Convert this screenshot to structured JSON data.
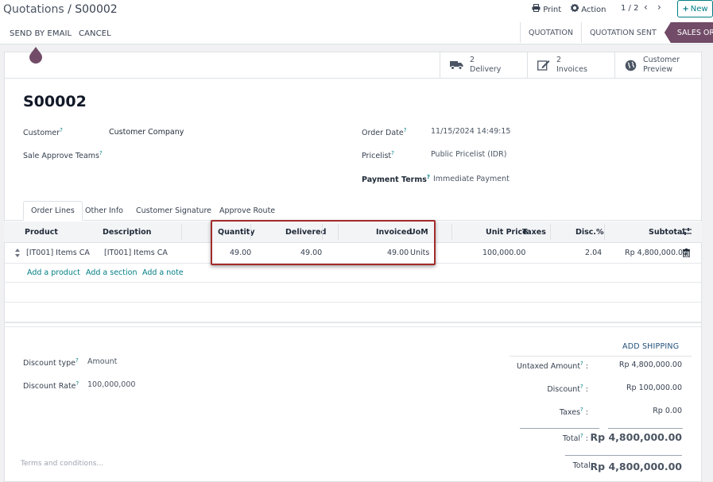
{
  "breadcrumb": {
    "parent": "Quotations",
    "separator": "/",
    "current": "S00002"
  },
  "header": {
    "print_label": "Print",
    "action_label": "Action",
    "pager": "1 / 2",
    "new_label": "New"
  },
  "toolbar": {
    "send_email_label": "SEND BY EMAIL",
    "cancel_label": "CANCEL"
  },
  "statusbar": {
    "stages": [
      {
        "label": "QUOTATION"
      },
      {
        "label": "QUOTATION SENT"
      },
      {
        "label": "SALES ORDER"
      }
    ]
  },
  "smart_buttons": {
    "delivery": {
      "count": "2",
      "label": "Delivery"
    },
    "invoices": {
      "count": "2",
      "label": "Invoices"
    },
    "preview": {
      "line1": "Customer",
      "line2": "Preview"
    }
  },
  "order": {
    "name": "S00002",
    "customer_label": "Customer",
    "customer_value": "Customer Company",
    "approve_teams_label": "Sale Approve Teams",
    "order_date_label": "Order Date",
    "order_date_value": "11/15/2024 14:49:15",
    "pricelist_label": "Pricelist",
    "pricelist_value": "Public Pricelist (IDR)",
    "payment_terms_label": "Payment Terms",
    "payment_terms_value": "Immediate Payment",
    "help_mark": "?"
  },
  "tabs": [
    {
      "label": "Order Lines"
    },
    {
      "label": "Other Info"
    },
    {
      "label": "Customer Signature"
    },
    {
      "label": "Approve Route"
    }
  ],
  "table": {
    "columns": {
      "product": "Product",
      "description": "Description",
      "quantity": "Quantity",
      "delivered": "Delivered",
      "invoiced": "Invoiced",
      "uom": "UoM",
      "unit_price": "Unit Price",
      "taxes": "Taxes",
      "disc": "Disc.%",
      "subtotal": "Subtotal"
    },
    "rows": [
      {
        "product": "[IT001] Items CA",
        "description": "[IT001] Items CA",
        "quantity": "49.00",
        "delivered": "49.00",
        "invoiced": "49.00",
        "uom": "Units",
        "unit_price": "100,000.00",
        "disc": "2.04",
        "subtotal": "Rp 4,800,000.00"
      }
    ],
    "add_product": "Add a product",
    "add_section": "Add a section",
    "add_note": "Add a note"
  },
  "discount": {
    "type_label": "Discount type",
    "type_value": "Amount",
    "rate_label": "Discount Rate",
    "rate_value": "100,000,000"
  },
  "totals": {
    "add_shipping": "ADD SHIPPING",
    "untaxed_label": "Untaxed Amount",
    "untaxed_value": "Rp 4,800,000.00",
    "discount_label": "Discount",
    "discount_value": "Rp 100,000.00",
    "taxes_label": "Taxes",
    "taxes_value": "Rp 0.00",
    "total_label": "Total",
    "total_value": "Rp 4,800,000.00",
    "grand_label": "Total:",
    "grand_value": "Rp 4,800,000.00",
    "colon": ":"
  },
  "terms_placeholder": "Terms and conditions...",
  "colors": {
    "brand": "#714b67",
    "accent": "#017e84",
    "highlight": "#a32b2b"
  },
  "icons": {
    "print": "printer-icon",
    "action": "gear-icon",
    "delivery": "truck-icon",
    "invoices": "edit-icon",
    "preview": "globe-icon",
    "trash": "trash-icon",
    "settings": "sliders-icon",
    "handle": "drag-handle-icon"
  }
}
